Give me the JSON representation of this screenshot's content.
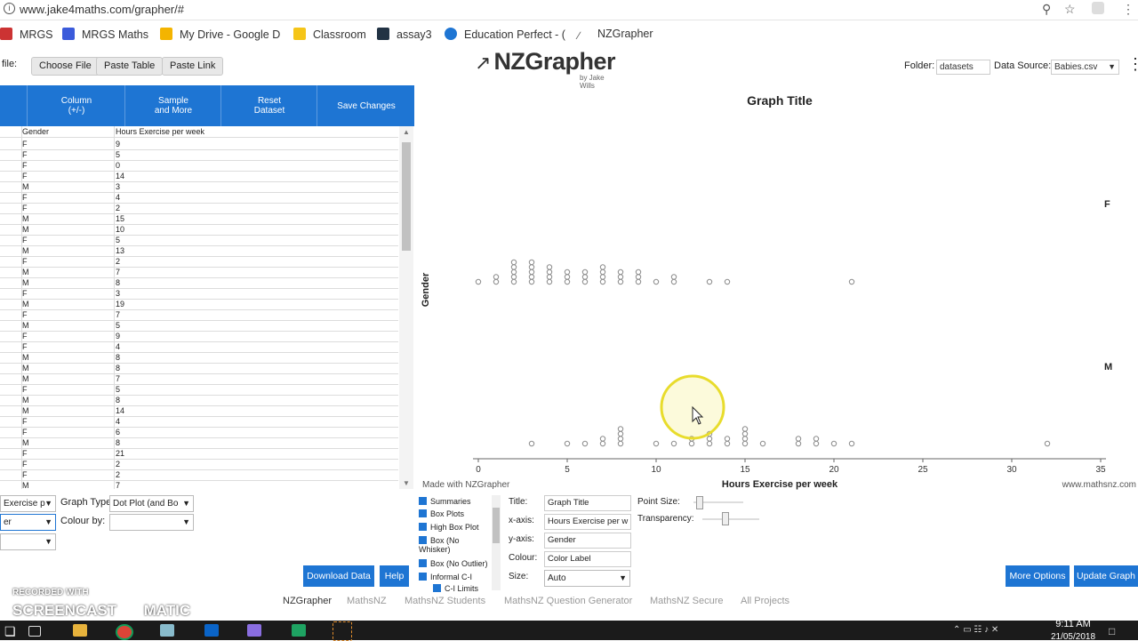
{
  "browser": {
    "url": "www.jake4maths.com/grapher/#",
    "bookmarks": [
      "MRGS",
      "MRGS Maths",
      "My Drive - Google D",
      "Classroom",
      "assay3",
      "Education Perfect - (",
      "NZGrapher"
    ]
  },
  "app": {
    "file_label": "file:",
    "buttons": {
      "choose_file": "Choose File",
      "paste_table": "Paste Table",
      "paste_link": "Paste Link"
    },
    "logo": "NZGrapher",
    "logo_sub": "by Jake Wills",
    "folder_label": "Folder:",
    "folder_value": "datasets",
    "source_label": "Data Source:",
    "source_value": "Babies.csv"
  },
  "toolbar": {
    "column": "Column\n(+/-)",
    "sample": "Sample\nand More",
    "reset": "Reset\nDataset",
    "save": "Save Changes"
  },
  "table": {
    "headers": [
      "Gender",
      "Hours Exercise per week"
    ],
    "rows": [
      [
        "F",
        "9"
      ],
      [
        "F",
        "5"
      ],
      [
        "F",
        "0"
      ],
      [
        "F",
        "14"
      ],
      [
        "M",
        "3"
      ],
      [
        "F",
        "4"
      ],
      [
        "F",
        "2"
      ],
      [
        "M",
        "15"
      ],
      [
        "M",
        "10"
      ],
      [
        "F",
        "5"
      ],
      [
        "M",
        "13"
      ],
      [
        "F",
        "2"
      ],
      [
        "M",
        "7"
      ],
      [
        "M",
        "8"
      ],
      [
        "F",
        "3"
      ],
      [
        "M",
        "19"
      ],
      [
        "F",
        "7"
      ],
      [
        "M",
        "5"
      ],
      [
        "F",
        "9"
      ],
      [
        "F",
        "4"
      ],
      [
        "M",
        "8"
      ],
      [
        "M",
        "8"
      ],
      [
        "M",
        "7"
      ],
      [
        "F",
        "5"
      ],
      [
        "M",
        "8"
      ],
      [
        "M",
        "14"
      ],
      [
        "F",
        "4"
      ],
      [
        "F",
        "6"
      ],
      [
        "M",
        "8"
      ],
      [
        "F",
        "21"
      ],
      [
        "F",
        "2"
      ],
      [
        "F",
        "2"
      ],
      [
        "M",
        "7"
      ]
    ]
  },
  "chart_data": {
    "type": "scatter",
    "title": "Graph Title",
    "xlabel": "Hours Exercise per week",
    "ylabel": "Gender",
    "xlim": [
      0,
      35
    ],
    "xticks": [
      0,
      5,
      10,
      15,
      20,
      25,
      30,
      35
    ],
    "series": [
      {
        "name": "F",
        "points": [
          [
            0,
            1
          ],
          [
            1,
            2
          ],
          [
            2,
            5
          ],
          [
            3,
            5
          ],
          [
            4,
            4
          ],
          [
            5,
            3
          ],
          [
            6,
            3
          ],
          [
            7,
            4
          ],
          [
            8,
            3
          ],
          [
            9,
            3
          ],
          [
            10,
            1
          ],
          [
            11,
            2
          ],
          [
            13,
            1
          ],
          [
            14,
            1
          ],
          [
            21,
            1
          ]
        ]
      },
      {
        "name": "M",
        "points": [
          [
            3,
            1
          ],
          [
            5,
            1
          ],
          [
            6,
            1
          ],
          [
            7,
            2
          ],
          [
            8,
            4
          ],
          [
            10,
            1
          ],
          [
            11,
            1
          ],
          [
            12,
            2
          ],
          [
            13,
            3
          ],
          [
            14,
            2
          ],
          [
            15,
            4
          ],
          [
            16,
            1
          ],
          [
            18,
            2
          ],
          [
            19,
            2
          ],
          [
            20,
            1
          ],
          [
            21,
            1
          ],
          [
            32,
            1
          ]
        ]
      }
    ],
    "made_with": "Made with NZGrapher",
    "website": "www.mathsnz.com"
  },
  "controls": {
    "var1_value": "Exercise p",
    "graph_type_label": "Graph Type:",
    "graph_type_value": "Dot Plot (and Bo",
    "var2_value": "er",
    "colour_by_label": "Colour by:",
    "colour_by_value": "",
    "download": "Download Data",
    "help": "Help",
    "checkboxes": [
      "Summaries",
      "Box Plots",
      "High Box Plot",
      "Box (No Whisker)",
      "Box (No Outlier)",
      "Informal C-I",
      "C-I Limits"
    ],
    "fields": {
      "title_label": "Title:",
      "title_value": "Graph Title",
      "xaxis_label": "x-axis:",
      "xaxis_value": "Hours Exercise per w",
      "yaxis_label": "y-axis:",
      "yaxis_value": "Gender",
      "colour_label": "Colour:",
      "colour_value": "Color Label",
      "size_label": "Size:",
      "size_value": "Auto"
    },
    "point_size_label": "Point Size:",
    "transparency_label": "Transparency:",
    "more_options": "More Options",
    "update_graph": "Update Graph"
  },
  "footer_links": [
    "NZGrapher",
    "MathsNZ",
    "MathsNZ Students",
    "MathsNZ Question Generator",
    "MathsNZ Secure",
    "All Projects"
  ],
  "watermark": {
    "line1": "RECORDED WITH",
    "line2": "SCREENCAST",
    "line3": "MATIC"
  },
  "taskbar": {
    "time": "9:11 AM",
    "date": "21/05/2018"
  },
  "colors": {
    "accent": "#1e75d3",
    "taskbar": "#1b1b1b",
    "cursor_highlight": "#f2e84a"
  },
  "icons": [
    "info-icon",
    "zoom-icon",
    "star-icon",
    "menu-dots-icon",
    "windows-start-icon",
    "chrome-icon"
  ]
}
